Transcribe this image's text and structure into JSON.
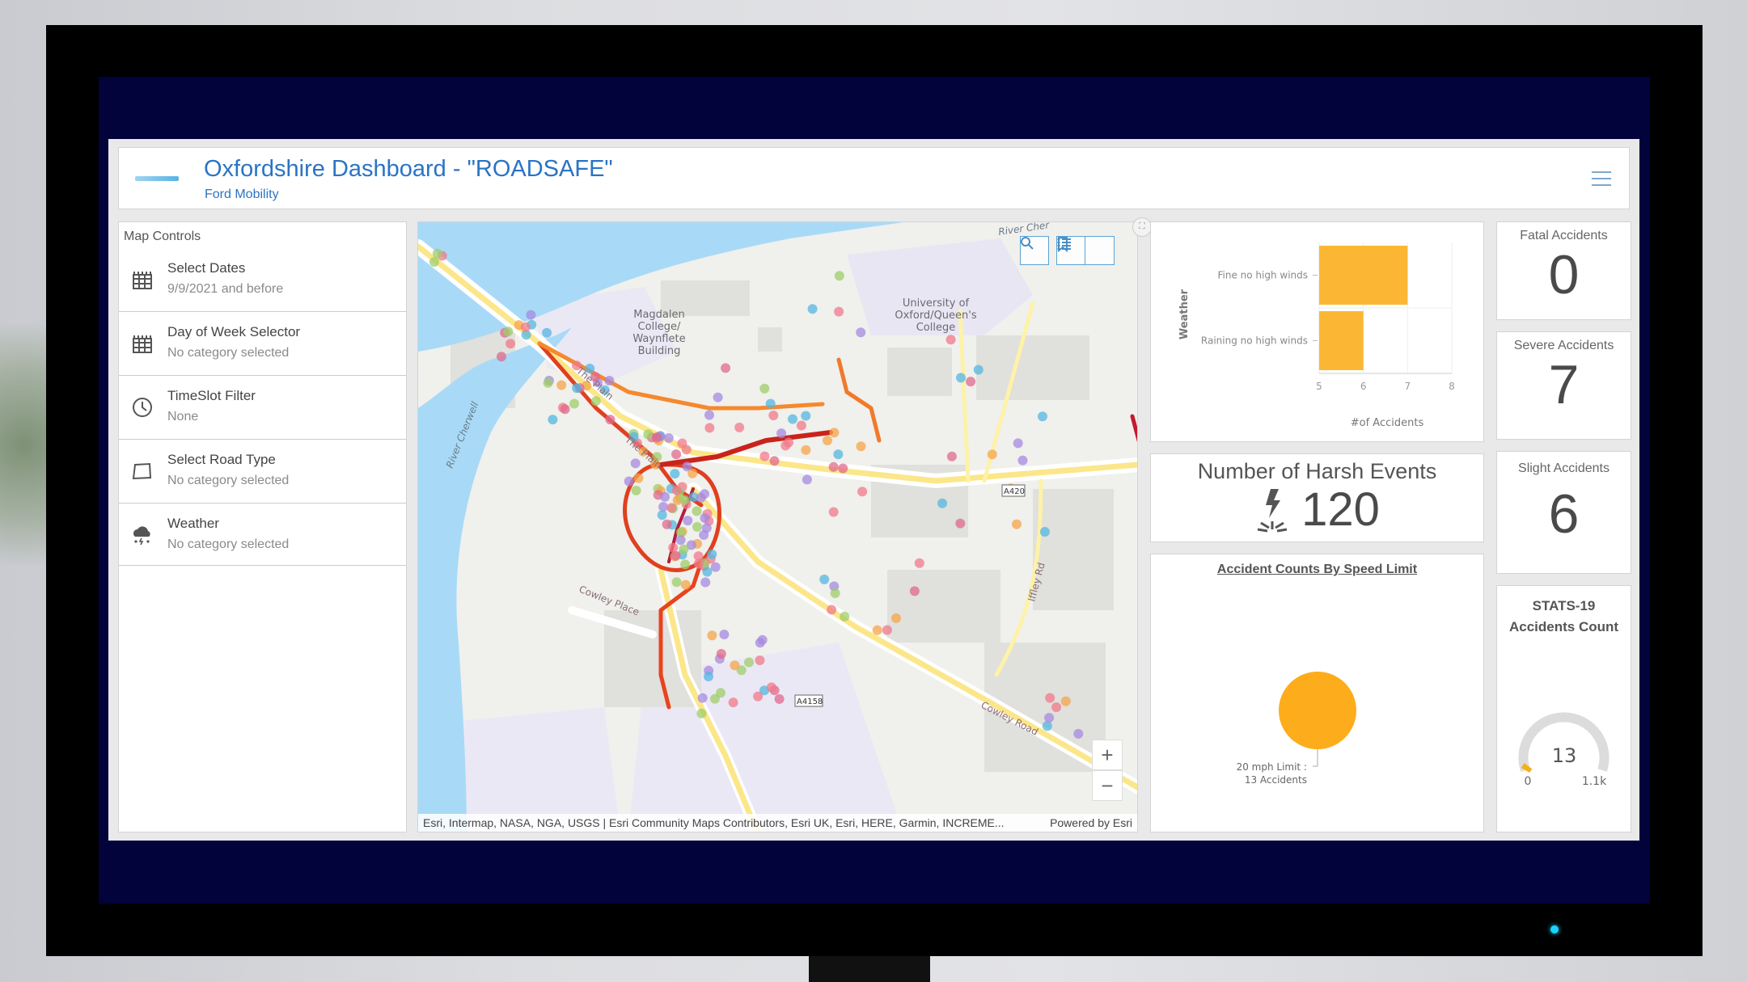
{
  "header": {
    "logo_alt": "FORD MOBILITY",
    "title": "Oxfordshire Dashboard - \"ROADSAFE\"",
    "subtitle": "Ford Mobility"
  },
  "sidebar": {
    "title": "Map Controls",
    "items": [
      {
        "label": "Select Dates",
        "value": "9/9/2021 and before",
        "icon": "calendar-icon"
      },
      {
        "label": "Day of Week Selector",
        "value": "No category selected",
        "icon": "calendar-icon"
      },
      {
        "label": "TimeSlot Filter",
        "value": "None",
        "icon": "clock-icon"
      },
      {
        "label": "Select Road Type",
        "value": "No category selected",
        "icon": "map-shape-icon"
      },
      {
        "label": "Weather",
        "value": "No category selected",
        "icon": "storm-cloud-icon"
      }
    ]
  },
  "map": {
    "labels": {
      "magdalen": [
        "Magdalen",
        "College/",
        "Waynflete",
        "Building"
      ],
      "university": [
        "University of",
        "Oxford/Queen's",
        "College"
      ],
      "river_cherwell": "River Cherwell",
      "river_top": "River Cher",
      "the_plain_1": "The Plain",
      "the_plain_2": "The Plain",
      "cowley_place": "Cowley Place",
      "cowley_road": "Cowley Road",
      "a420": "A420",
      "a4158": "A4158",
      "iffley": "Iffley Rd"
    },
    "attribution": "Esri, Intermap, NASA, NGA, USGS | Esri Community Maps Contributors, Esri UK, Esri, HERE, Garmin, INCREME...",
    "powered_by": "Powered by Esri",
    "tools": [
      "search-icon",
      "bookmark-icon",
      "legend-list-icon"
    ],
    "zoom_in": "+",
    "zoom_out": "−",
    "colors": {
      "water": "#a8daf7",
      "road_major": "#fbe68a",
      "route_red": "#d8321c",
      "route_orange": "#f28a2c"
    }
  },
  "chart_data": [
    {
      "type": "bar",
      "orientation": "horizontal",
      "title": "",
      "categories": [
        "Fine no high winds",
        "Raining no high winds"
      ],
      "values": [
        7,
        6
      ],
      "xlabel": "#of Accidents",
      "ylabel": "Weather",
      "xlim": [
        5,
        8
      ],
      "xticks": [
        "5",
        "6",
        "7",
        "8"
      ],
      "grid": true,
      "color": "#fbb733"
    },
    {
      "type": "pie",
      "title": "Accident Counts By Speed Limit",
      "categories": [
        "20 mph Limit"
      ],
      "values": [
        13
      ],
      "labels": [
        "20 mph Limit :",
        "13 Accidents"
      ],
      "color": "#fdad1b"
    },
    {
      "type": "gauge",
      "title": "STATS-19 Accidents Count",
      "value": 13,
      "min_label": "0",
      "max_label": "1.1k",
      "min": 0,
      "max": 1100
    }
  ],
  "harsh_events": {
    "title": "Number of Harsh Events",
    "value": "120"
  },
  "stats": [
    {
      "title": "Fatal Accidents",
      "value": "0"
    },
    {
      "title": "Severe Accidents",
      "value": "7"
    },
    {
      "title": "Slight Accidents",
      "value": "6"
    }
  ],
  "gauge": {
    "title_line1": "STATS-19",
    "title_line2": "Accidents Count",
    "value": "13",
    "min": "0",
    "max": "1.1k"
  }
}
